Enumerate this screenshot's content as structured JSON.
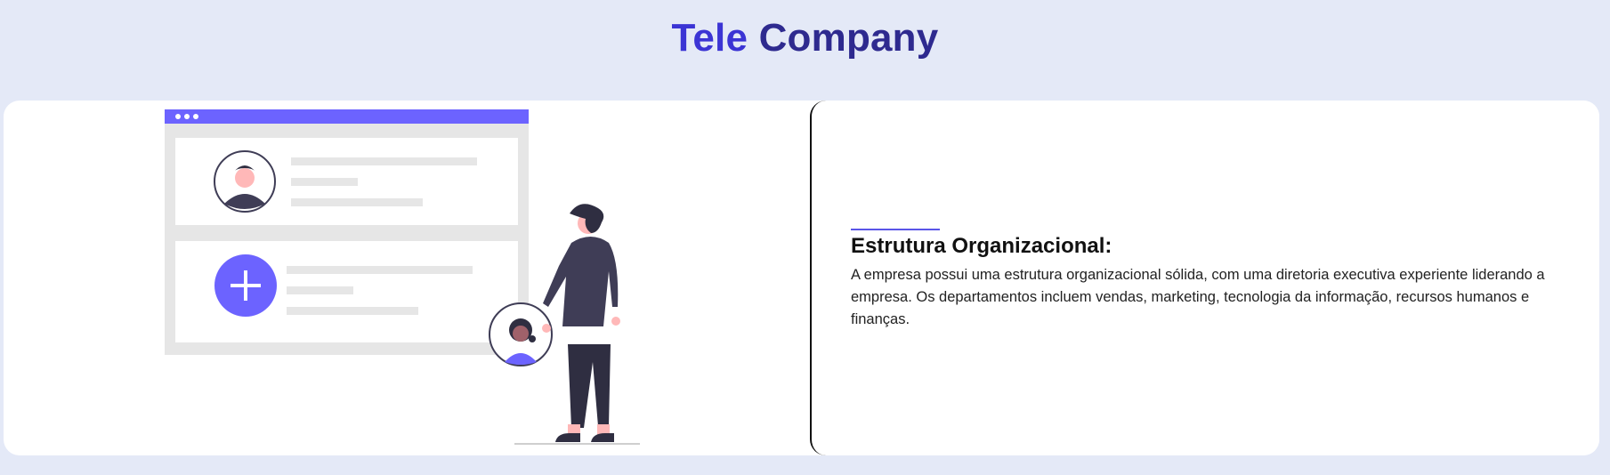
{
  "header": {
    "brand_word1": "Tele",
    "brand_word2": "Company"
  },
  "section": {
    "title": "Estrutura Organizacional:",
    "body": "A empresa possui uma estrutura organizacional sólida, com uma diretoria executiva experiente liderando a empresa. Os departamentos incluem vendas, marketing, tecnologia da informação, recursos humanos e finanças."
  },
  "colors": {
    "page_bg": "#e4e9f7",
    "brand_primary": "#3b34d4",
    "brand_dark": "#2e2a8f",
    "accent": "#6c63ff",
    "figure_dark": "#3f3d56"
  },
  "icons": [
    "browser-window-illustration",
    "person-avatar-icon",
    "plus-icon",
    "headset-support-avatar-icon",
    "standing-person-illustration"
  ]
}
